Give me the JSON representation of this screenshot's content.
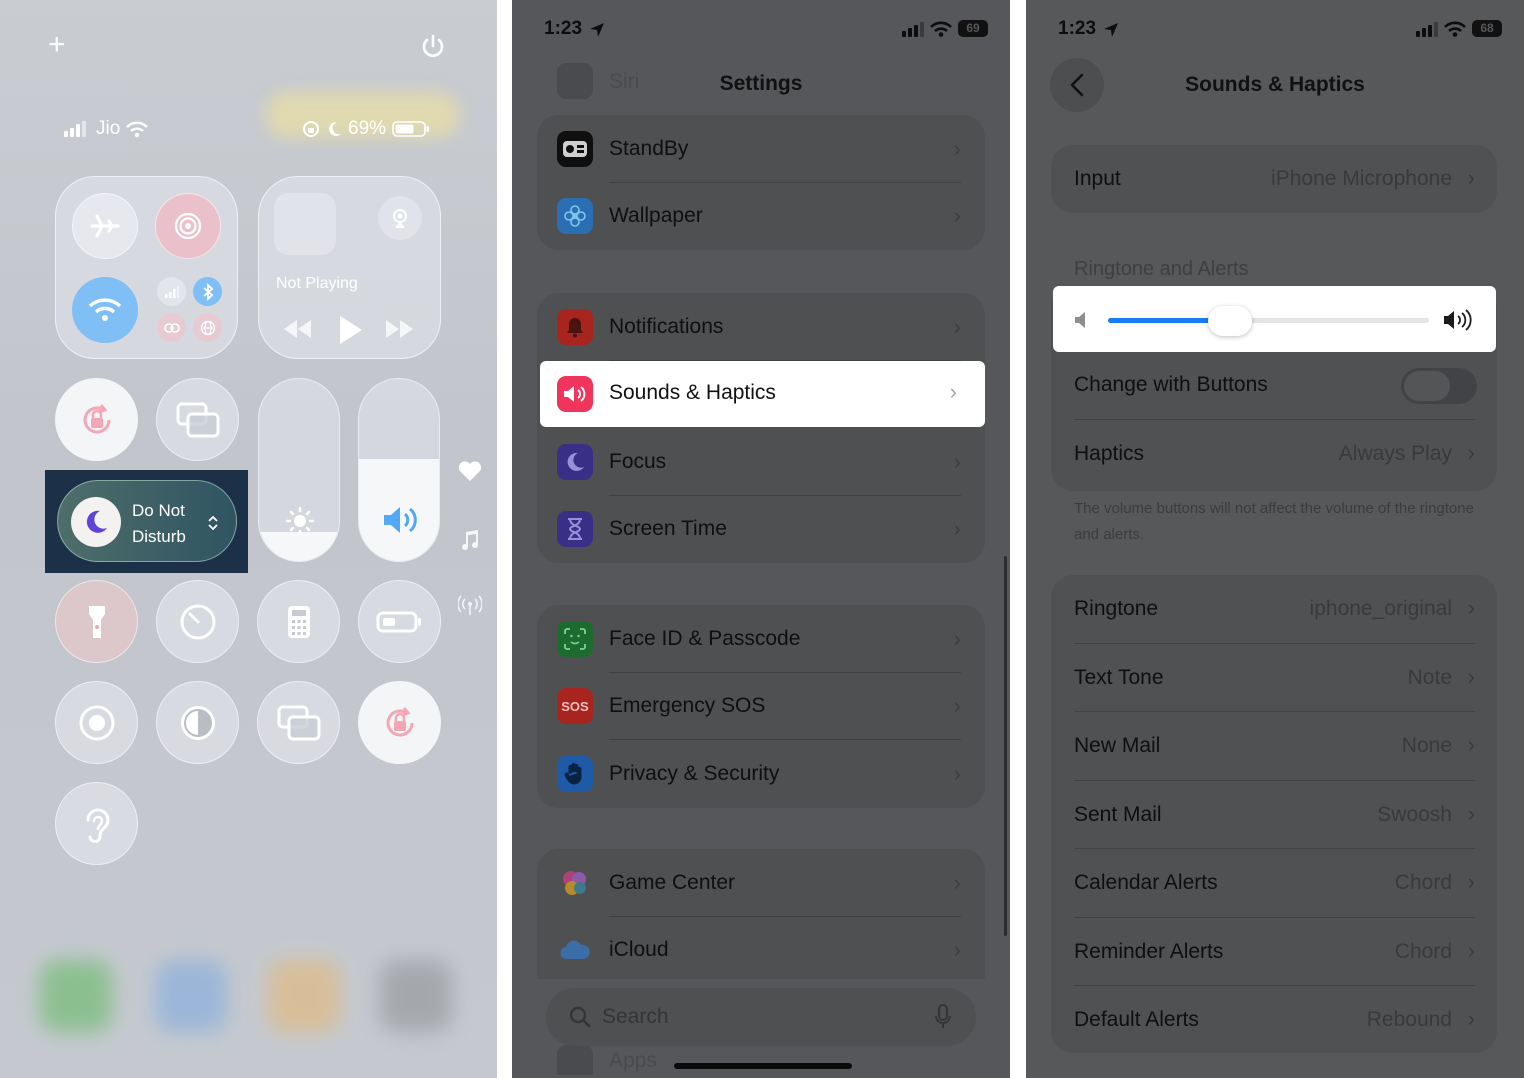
{
  "control_center": {
    "add_icon": "+",
    "power_icon": "power-icon",
    "carrier": "Jio",
    "battery_percent": "69%",
    "now_playing": "Not Playing",
    "dnd_line1": "Do Not",
    "dnd_line2": "Disturb",
    "brightness_level": 0.16,
    "volume_level": 0.56,
    "colors": {
      "dnd_bg": "#1c3148",
      "tile_fill": "#f6f7f9",
      "accent_blue": "#52a8f5"
    }
  },
  "settings": {
    "status": {
      "time": "1:23",
      "battery": "69"
    },
    "title": "Settings",
    "groups": [
      {
        "rows": [
          {
            "label": "StandBy",
            "icon": "standby-icon",
            "color": "#0f0f0f"
          },
          {
            "label": "Wallpaper",
            "icon": "flower-icon",
            "color": "#2a6fb3"
          }
        ]
      },
      {
        "rows": [
          {
            "label": "Notifications",
            "icon": "bell-icon",
            "color": "#a8241f"
          },
          {
            "label": "Sounds & Haptics",
            "icon": "speaker-icon",
            "color": "#f1345b"
          },
          {
            "label": "Focus",
            "icon": "moon-icon",
            "color": "#3a2f86"
          },
          {
            "label": "Screen Time",
            "icon": "hourglass-icon",
            "color": "#3a2f86"
          }
        ]
      },
      {
        "rows": [
          {
            "label": "Face ID & Passcode",
            "icon": "faceid-icon",
            "color": "#1d6b31"
          },
          {
            "label": "Emergency SOS",
            "icon": "sos-icon",
            "color": "#a8241f"
          },
          {
            "label": "Privacy & Security",
            "icon": "hand-icon",
            "color": "#1e5aa8"
          }
        ]
      },
      {
        "rows": [
          {
            "label": "Game Center",
            "icon": "gamecenter-icon",
            "color": "#7a4fa0"
          },
          {
            "label": "iCloud",
            "icon": "cloud-icon",
            "color": "#3b6ea6"
          }
        ]
      }
    ],
    "search_placeholder": "Search",
    "partial_top": "Siri",
    "partial_bottom": "Apps"
  },
  "sounds": {
    "status": {
      "time": "1:23",
      "battery": "68"
    },
    "title": "Sounds & Haptics",
    "input": {
      "label": "Input",
      "value": "iPhone Microphone"
    },
    "section_header": "Ringtone and Alerts",
    "volume_level": 0.36,
    "change_with_buttons": {
      "label": "Change with Buttons",
      "on": false
    },
    "haptics": {
      "label": "Haptics",
      "value": "Always Play"
    },
    "footnote": "The volume buttons will not affect the volume of the ringtone and alerts.",
    "tones": [
      {
        "label": "Ringtone",
        "value": "iphone_original"
      },
      {
        "label": "Text Tone",
        "value": "Note"
      },
      {
        "label": "New Mail",
        "value": "None"
      },
      {
        "label": "Sent Mail",
        "value": "Swoosh"
      },
      {
        "label": "Calendar Alerts",
        "value": "Chord"
      },
      {
        "label": "Reminder Alerts",
        "value": "Chord"
      },
      {
        "label": "Default Alerts",
        "value": "Rebound"
      }
    ],
    "colors": {
      "accent": "#1a7cf5"
    }
  }
}
